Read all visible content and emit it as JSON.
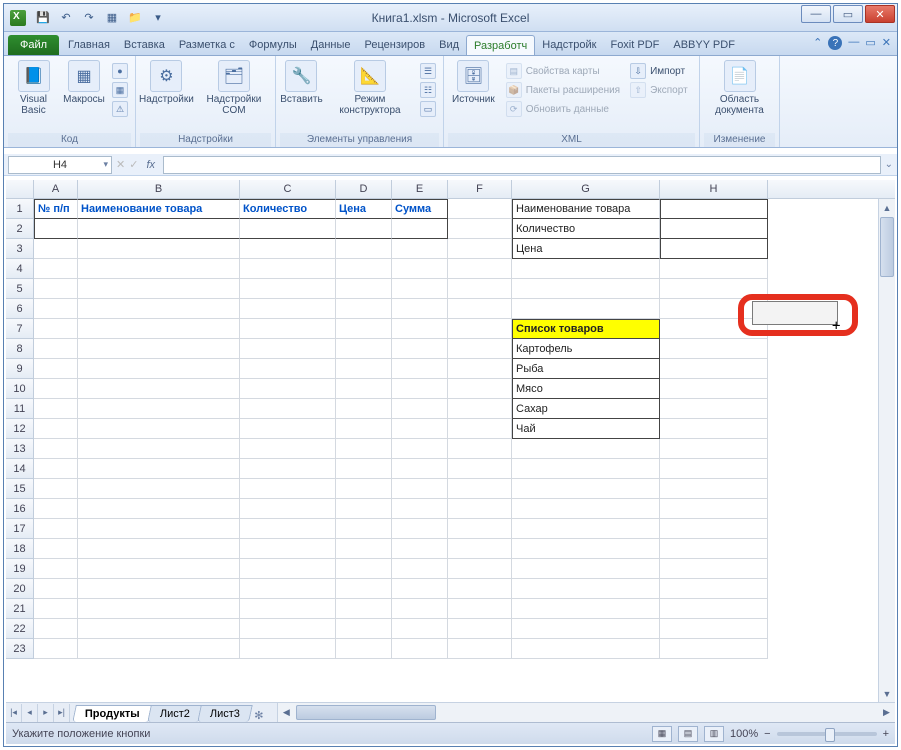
{
  "title": "Книга1.xlsm - Microsoft Excel",
  "qat": {
    "save": "💾",
    "undo": "↶",
    "redo": "↷",
    "new": "▦",
    "open": "📁"
  },
  "tabs": {
    "file": "Файл",
    "list": [
      "Главная",
      "Вставка",
      "Разметка с",
      "Формулы",
      "Данные",
      "Рецензиров",
      "Вид",
      "Разработч",
      "Надстройк",
      "Foxit PDF",
      "ABBYY PDF"
    ],
    "active_index": 7
  },
  "ribbon": {
    "code": {
      "label": "Код",
      "vb": "Visual Basic",
      "macros": "Макросы"
    },
    "addins": {
      "label": "Надстройки",
      "addins": "Надстройки",
      "com": "Надстройки COM"
    },
    "controls": {
      "label": "Элементы управления",
      "insert": "Вставить",
      "design": "Режим конструктора"
    },
    "xml": {
      "label": "XML",
      "source": "Источник",
      "map_props": "Свойства карты",
      "exp_packs": "Пакеты расширения",
      "refresh": "Обновить данные",
      "import": "Импорт",
      "export": "Экспорт"
    },
    "modify": {
      "label": "Изменение",
      "doc_area": "Область документа"
    }
  },
  "namebox": "H4",
  "fx": "fx",
  "cols": [
    "A",
    "B",
    "C",
    "D",
    "E",
    "F",
    "G",
    "H"
  ],
  "row_count": 23,
  "headers_row1": {
    "A": "№ п/п",
    "B": "Наименование товара",
    "C": "Количество",
    "D": "Цена",
    "E": "Сумма"
  },
  "side_labels": {
    "G1": "Наименование товара",
    "G2": "Количество",
    "G3": "Цена"
  },
  "list_header": "Список товаров",
  "list_items": [
    "Картофель",
    "Рыба",
    "Мясо",
    "Сахар",
    "Чай"
  ],
  "sheets": {
    "tabs": [
      "Продукты",
      "Лист2",
      "Лист3"
    ],
    "active": 0
  },
  "status": {
    "left": "Укажите положение кнопки",
    "zoom": "100%"
  }
}
